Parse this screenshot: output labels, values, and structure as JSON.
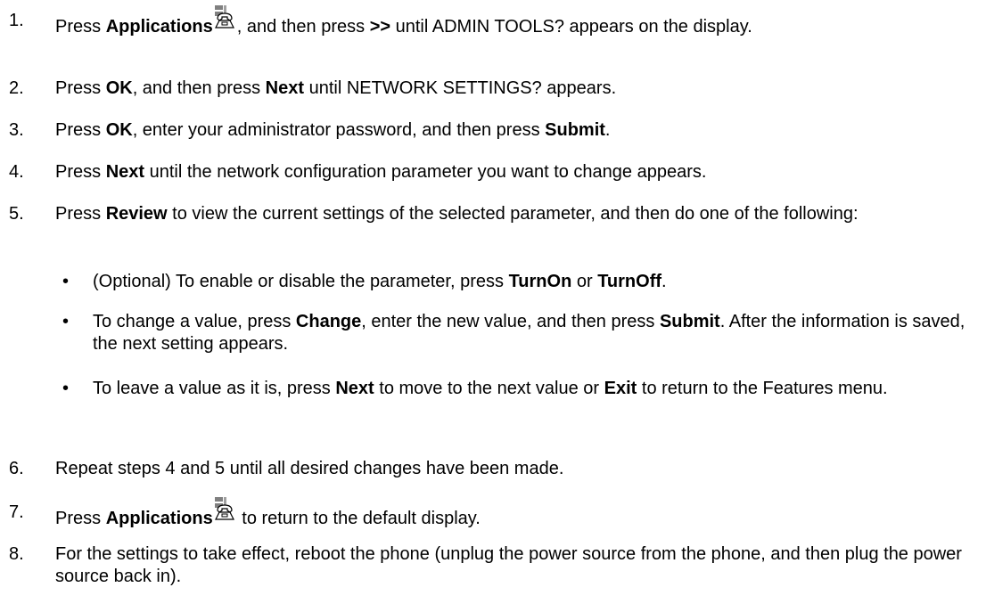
{
  "steps": [
    {
      "num": "1.",
      "press": "Press ",
      "key": "Applications",
      "icon": "applications-phone-icon",
      "text_a": ", and then press ",
      "key2": ">>",
      "text_b": " until ADMIN TOOLS? appears on the display."
    },
    {
      "num": "2.",
      "press": "Press ",
      "key": "OK",
      "text_a": ", and then press ",
      "key2": "Next",
      "text_b": " until NETWORK SETTINGS? appears."
    },
    {
      "num": "3.",
      "press": "Press ",
      "key": "OK",
      "text_a": ", enter your administrator password, and then press ",
      "key2": "Submit",
      "text_b": "."
    },
    {
      "num": "4.",
      "press": "Press ",
      "key": "Next",
      "text_a": " until the network configuration parameter you want to change appears."
    },
    {
      "num": "5.",
      "press": "Press ",
      "key": "Review",
      "text_a": " to view the current settings of the selected parameter, and then do one of the following:",
      "bullets": [
        {
          "dot": "•",
          "text_a": "(Optional) To enable or disable the parameter, press ",
          "key": "TurnOn",
          "text_b": " or ",
          "key2": "TurnOff",
          "text_c": "."
        },
        {
          "dot": "•",
          "text_a": "To change a value, press ",
          "key": "Change",
          "text_b": ", enter the new value, and then press ",
          "key2": "Submit",
          "text_c": ". After the information is saved, the next setting appears."
        },
        {
          "dot": "•",
          "text_a": "To leave a value as it is, press ",
          "key": "Next",
          "text_b": " to move to the next value or ",
          "key2": "Exit",
          "text_c": " to return to the Features menu."
        }
      ]
    },
    {
      "num": "6.",
      "text_a": "Repeat steps 4 and 5 until all desired changes have been made."
    },
    {
      "num": "7.",
      "press": "Press ",
      "key": "Applications",
      "icon": "applications-phone-icon",
      "text_a": " to return to the default display."
    },
    {
      "num": "8.",
      "text_a": "For the settings to take effect, reboot the phone (unplug the power source from the phone, and then plug the power source back in)."
    }
  ]
}
